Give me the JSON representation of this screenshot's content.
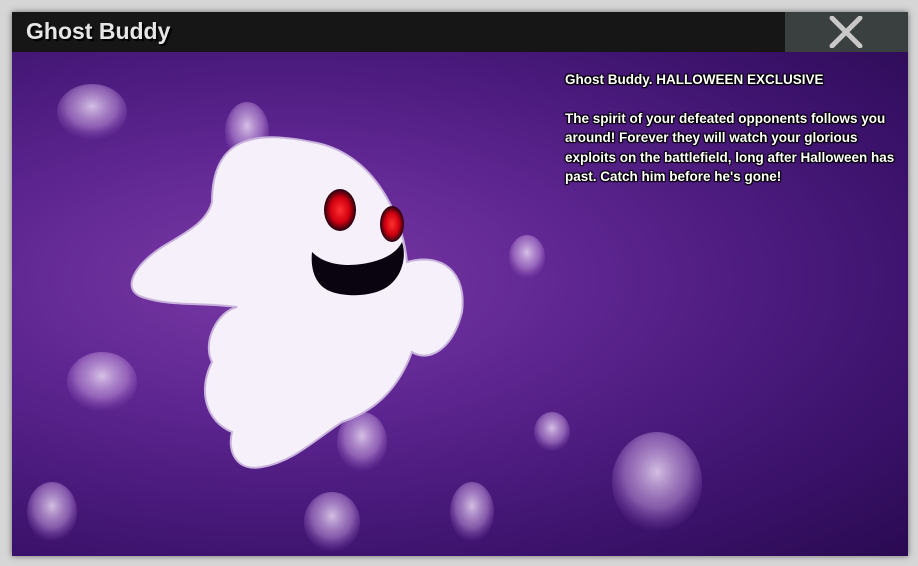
{
  "window": {
    "title": "Ghost Buddy",
    "close_icon": "close-x-icon"
  },
  "item": {
    "heading": "Ghost Buddy. HALLOWEEN EXCLUSIVE",
    "description": "The spirit of your defeated opponents follows you around! Forever they will watch your glorious exploits on the battlefield, long after Halloween has past. Catch him before he's gone!"
  },
  "colors": {
    "titlebar": "#161616",
    "close_bg": "#3a3f40",
    "background": "#5d2590",
    "eye": "#e01020"
  }
}
